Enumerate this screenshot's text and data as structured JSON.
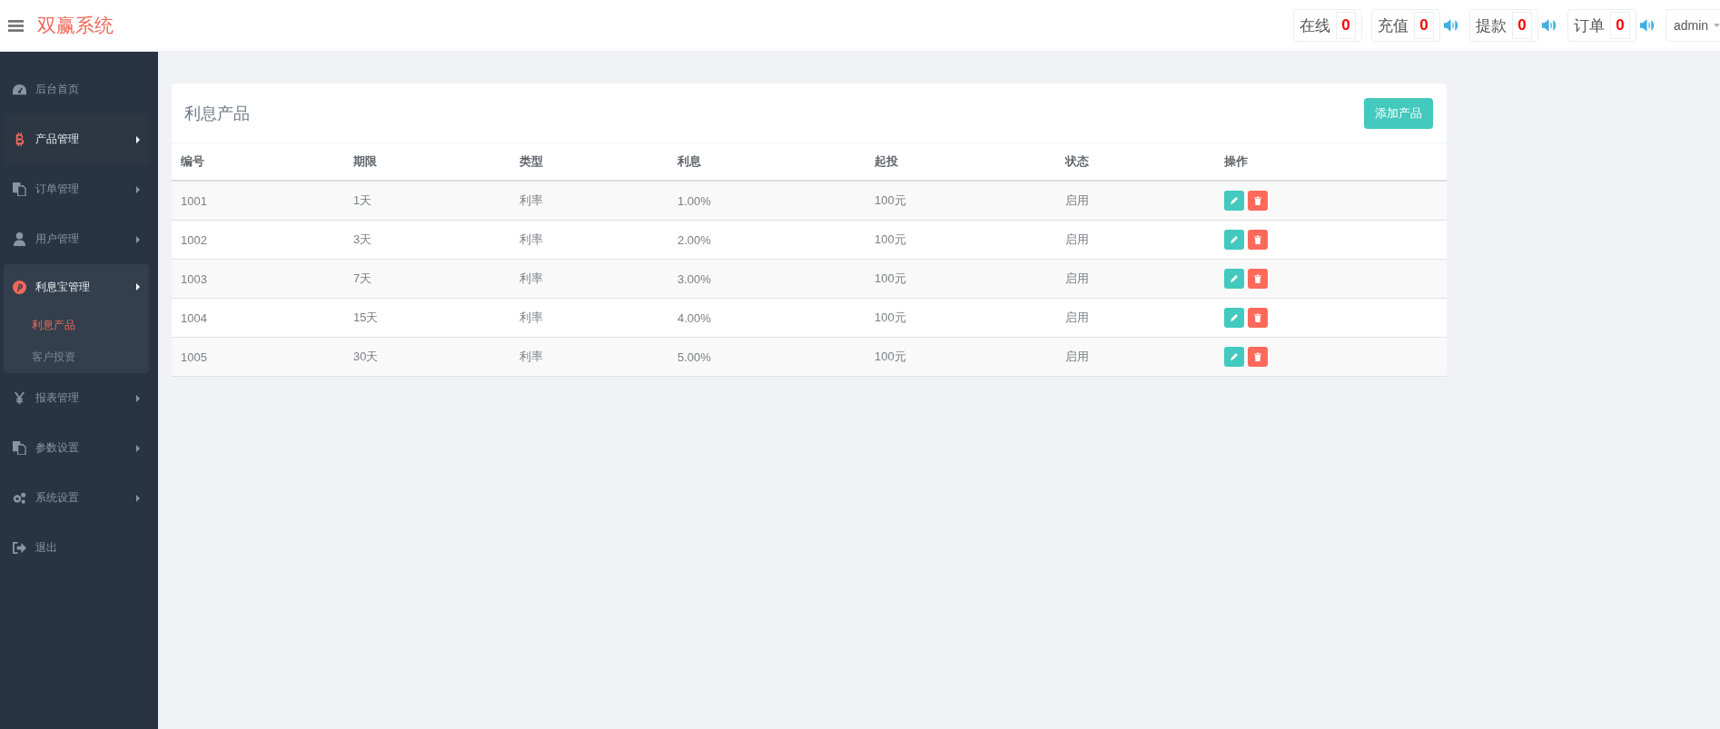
{
  "header": {
    "title": "双赢系统",
    "counters": [
      {
        "label": "在线",
        "value": "0",
        "kind": "plain"
      },
      {
        "label": "充值",
        "value": "0",
        "kind": "alert"
      },
      {
        "label": "提款",
        "value": "0",
        "kind": "alert"
      },
      {
        "label": "订单",
        "value": "0",
        "kind": "alert"
      }
    ],
    "user": "admin"
  },
  "sidebar": {
    "items": [
      {
        "label": "后台首页",
        "expanded": false,
        "hovered": false
      },
      {
        "label": "产品管理",
        "expanded": false,
        "hovered": true
      },
      {
        "label": "订单管理",
        "expanded": false,
        "hovered": false
      },
      {
        "label": "用户管理",
        "expanded": false,
        "hovered": false
      },
      {
        "label": "利息宝管理",
        "expanded": true,
        "hovered": false,
        "children": [
          {
            "label": "利息产品",
            "selected": true
          },
          {
            "label": "客户投资",
            "selected": false
          }
        ]
      },
      {
        "label": "报表管理",
        "expanded": false,
        "hovered": false
      },
      {
        "label": "参数设置",
        "expanded": false,
        "hovered": false
      },
      {
        "label": "系统设置",
        "expanded": false,
        "hovered": false
      },
      {
        "label": "退出",
        "expanded": false,
        "hovered": false
      }
    ]
  },
  "card": {
    "title": "利息产品",
    "add_button": "添加产品",
    "table": {
      "columns": [
        "编号",
        "期限",
        "类型",
        "利息",
        "起投",
        "状态",
        "操作"
      ],
      "rows": [
        [
          "1001",
          "1天",
          "利率",
          "1.00%",
          "100元",
          "启用"
        ],
        [
          "1002",
          "3天",
          "利率",
          "2.00%",
          "100元",
          "启用"
        ],
        [
          "1003",
          "7天",
          "利率",
          "3.00%",
          "100元",
          "启用"
        ],
        [
          "1004",
          "15天",
          "利率",
          "4.00%",
          "100元",
          "启用"
        ],
        [
          "1005",
          "30天",
          "利率",
          "5.00%",
          "100元",
          "启用"
        ]
      ]
    }
  }
}
